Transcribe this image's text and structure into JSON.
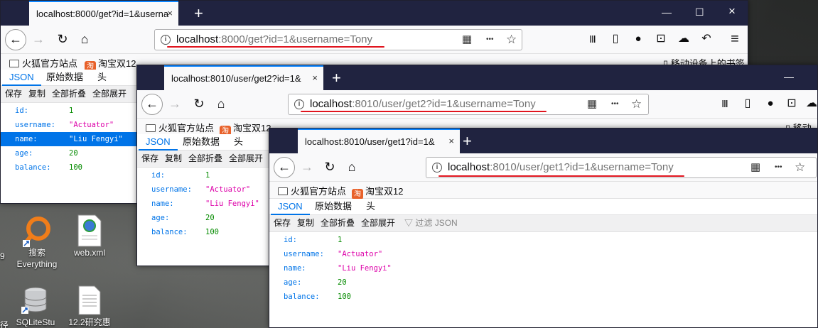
{
  "desktop": {
    "icons": [
      {
        "label1": "搜索",
        "label2": "Everything"
      },
      {
        "label1": "web.xml",
        "label2": ""
      },
      {
        "label1": "SQLiteStu",
        "label2": ""
      },
      {
        "label1": "12.2研究惠",
        "label2": ""
      }
    ],
    "edge_digit": "9",
    "edge_glyph": "径"
  },
  "windows": [
    {
      "tab_title": "localhost:8000/get?id=1&userna",
      "url_host": "localhost",
      "url_rest": ":8000/get?id=1&username=Tony",
      "bookmarks": {
        "folder": "火狐官方站点",
        "taobao": "淘宝双12",
        "taobao_icon": "淘",
        "mobile": "移动设备上的书签"
      },
      "json_tabs": [
        "JSON",
        "原始数据",
        "头"
      ],
      "tools": [
        "保存",
        "复制",
        "全部折叠",
        "全部展开"
      ],
      "rows": [
        {
          "key": "id:",
          "value": "1",
          "type": "num"
        },
        {
          "key": "username:",
          "value": "\"Actuator\"",
          "type": "str"
        },
        {
          "key": "name:",
          "value": "\"Liu Fengyi\"",
          "type": "str",
          "selected": true
        },
        {
          "key": "age:",
          "value": "20",
          "type": "num"
        },
        {
          "key": "balance:",
          "value": "100",
          "type": "num"
        }
      ]
    },
    {
      "tab_title": "localhost:8010/user/get2?id=1&",
      "url_host": "localhost",
      "url_rest": ":8010/user/get2?id=1&username=Tony",
      "bookmarks": {
        "folder": "火狐官方站点",
        "taobao": "淘宝双12",
        "taobao_icon": "淘",
        "mobile": "移动"
      },
      "json_tabs": [
        "JSON",
        "原始数据",
        "头"
      ],
      "tools": [
        "保存",
        "复制",
        "全部折叠",
        "全部展开"
      ],
      "rows": [
        {
          "key": "id:",
          "value": "1",
          "type": "num"
        },
        {
          "key": "username:",
          "value": "\"Actuator\"",
          "type": "str"
        },
        {
          "key": "name:",
          "value": "\"Liu Fengyi\"",
          "type": "str"
        },
        {
          "key": "age:",
          "value": "20",
          "type": "num"
        },
        {
          "key": "balance:",
          "value": "100",
          "type": "num"
        }
      ]
    },
    {
      "tab_title": "localhost:8010/user/get1?id=1&",
      "url_host": "localhost",
      "url_rest": ":8010/user/get1?id=1&username=Tony",
      "bookmarks": {
        "folder": "火狐官方站点",
        "taobao": "淘宝双12",
        "taobao_icon": "淘"
      },
      "json_tabs": [
        "JSON",
        "原始数据",
        "头"
      ],
      "tools": [
        "保存",
        "复制",
        "全部折叠",
        "全部展开"
      ],
      "filter": "过滤 JSON",
      "rows": [
        {
          "key": "id:",
          "value": "1",
          "type": "num"
        },
        {
          "key": "username:",
          "value": "\"Actuator\"",
          "type": "str"
        },
        {
          "key": "name:",
          "value": "\"Liu Fengyi\"",
          "type": "str"
        },
        {
          "key": "age:",
          "value": "20",
          "type": "num"
        },
        {
          "key": "balance:",
          "value": "100",
          "type": "num"
        }
      ]
    }
  ],
  "glyphs": {
    "close": "×",
    "plus": "+",
    "minimize": "—",
    "maximize": "☐",
    "back": "←",
    "forward": "→",
    "reload": "↻",
    "home": "⌂",
    "info": "i",
    "qr": "▦",
    "more": "•••",
    "star": "☆",
    "library": "Ⅲ",
    "sidebar": "▯",
    "account": "●",
    "screenshot": "⊡",
    "chat": "☁",
    "undo": "↶",
    "menu": "≡",
    "phone": "▯",
    "filter": "▽"
  }
}
